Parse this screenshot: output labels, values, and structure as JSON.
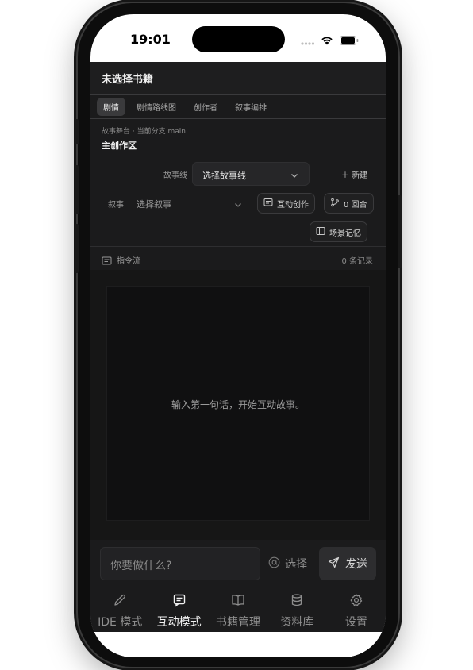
{
  "status_bar": {
    "time": "19:01"
  },
  "header": {
    "title": "未选择书籍"
  },
  "tabs": [
    {
      "label": "剧情",
      "active": true
    },
    {
      "label": "剧情路线图",
      "active": false
    },
    {
      "label": "创作者",
      "active": false
    },
    {
      "label": "叙事编排",
      "active": false
    }
  ],
  "breadcrumb": {
    "text": "故事舞台 · 当前分支 main"
  },
  "area_title": "主创作区",
  "storyline": {
    "label": "故事线",
    "select_value": "选择故事线",
    "new_label": "新建"
  },
  "narrative": {
    "label": "叙事",
    "select_value": "选择叙事",
    "interactive_button": "互动创作",
    "rounds_button": "0 回合",
    "scene_memory_button": "场景记忆"
  },
  "feed": {
    "label": "指令流",
    "count": "0 条记录",
    "empty_text": "输入第一句话，开始互动故事。"
  },
  "composer": {
    "placeholder": "你要做什么?",
    "select_label": "选择",
    "send_label": "发送"
  },
  "tabbar": {
    "items": [
      {
        "label": "IDE 模式",
        "icon": "pencil-icon",
        "active": false
      },
      {
        "label": "互动模式",
        "icon": "message-icon",
        "active": true
      },
      {
        "label": "书籍管理",
        "icon": "book-icon",
        "active": false
      },
      {
        "label": "资料库",
        "icon": "database-icon",
        "active": false
      },
      {
        "label": "设置",
        "icon": "gear-icon",
        "active": false
      }
    ]
  },
  "colors": {
    "app_bg": "#1b1b1c",
    "panel": "#262628",
    "text": "#f0f0f0",
    "muted": "#8a8a8a"
  }
}
